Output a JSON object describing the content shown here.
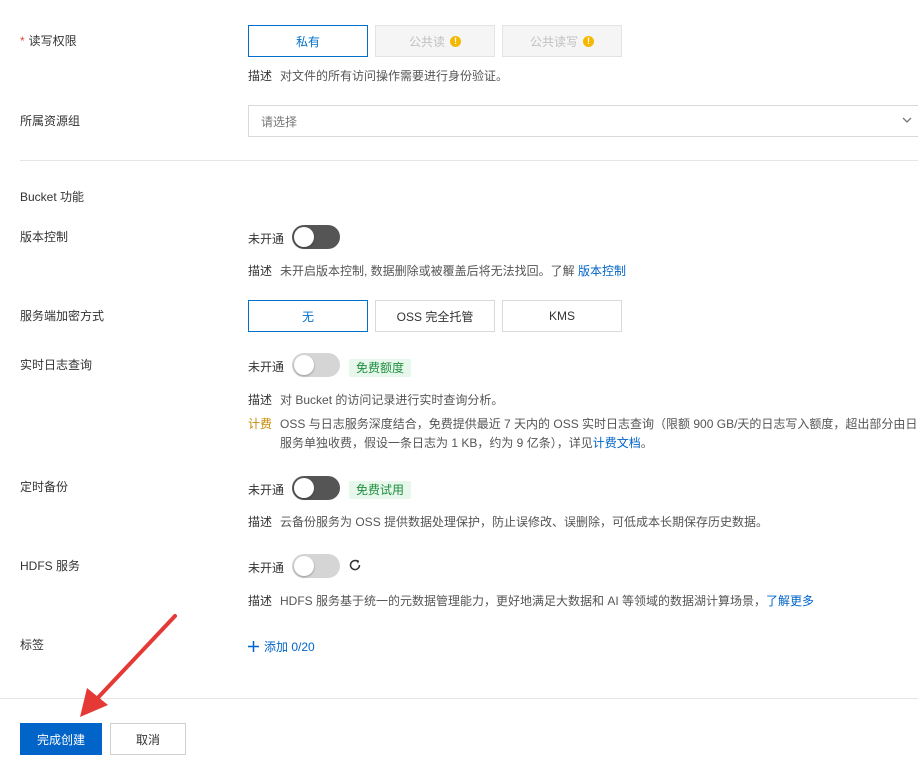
{
  "rw_permission": {
    "label": "读写权限",
    "required_mark": "*",
    "options": [
      "私有",
      "公共读",
      "公共读写"
    ],
    "warn_glyph": "!",
    "desc_key": "描述",
    "desc_text": "对文件的所有访问操作需要进行身份验证。"
  },
  "resource_group": {
    "label": "所属资源组",
    "placeholder": "请选择"
  },
  "bucket_features": {
    "title": "Bucket 功能"
  },
  "versioning": {
    "label": "版本控制",
    "switch_label": "未开通",
    "desc_key": "描述",
    "desc_text": "未开启版本控制, 数据删除或被覆盖后将无法找回。了解",
    "desc_link": "版本控制"
  },
  "encryption": {
    "label": "服务端加密方式",
    "options": [
      "无",
      "OSS 完全托管",
      "KMS"
    ]
  },
  "realtime_log": {
    "label": "实时日志查询",
    "switch_label": "未开通",
    "tag": "免费额度",
    "desc_key": "描述",
    "desc_text": "对 Bucket 的访问记录进行实时查询分析。",
    "fee_key": "计费",
    "fee_line1": "OSS 与日志服务深度结合，免费提供最近 7 天内的 OSS 实时日志查询（限额 900 GB/天的日志写入额度，超出部分由日志",
    "fee_line2": "服务单独收费，假设一条日志为 1 KB，约为 9 亿条），详见",
    "fee_link": "计费文档",
    "fee_end": "。"
  },
  "scheduled_backup": {
    "label": "定时备份",
    "switch_label": "未开通",
    "tag": "免费试用",
    "desc_key": "描述",
    "desc_text": "云备份服务为 OSS 提供数据处理保护，防止误修改、误删除，可低成本长期保存历史数据。"
  },
  "hdfs": {
    "label": "HDFS 服务",
    "switch_label": "未开通",
    "desc_key": "描述",
    "desc_text": "HDFS 服务基于统一的元数据管理能力，更好地满足大数据和 AI 等领域的数据湖计算场景，",
    "desc_link": "了解更多"
  },
  "tags": {
    "label": "标签",
    "add_label": "添加 0/20"
  },
  "footer": {
    "submit": "完成创建",
    "cancel": "取消"
  },
  "colors": {
    "primary": "#0064c8",
    "switch_off": "#555555",
    "free_tag_bg": "#e7f7ec",
    "free_tag_text": "#1e8e3e",
    "warning": "#f5b800",
    "arrow": "#e53935"
  }
}
